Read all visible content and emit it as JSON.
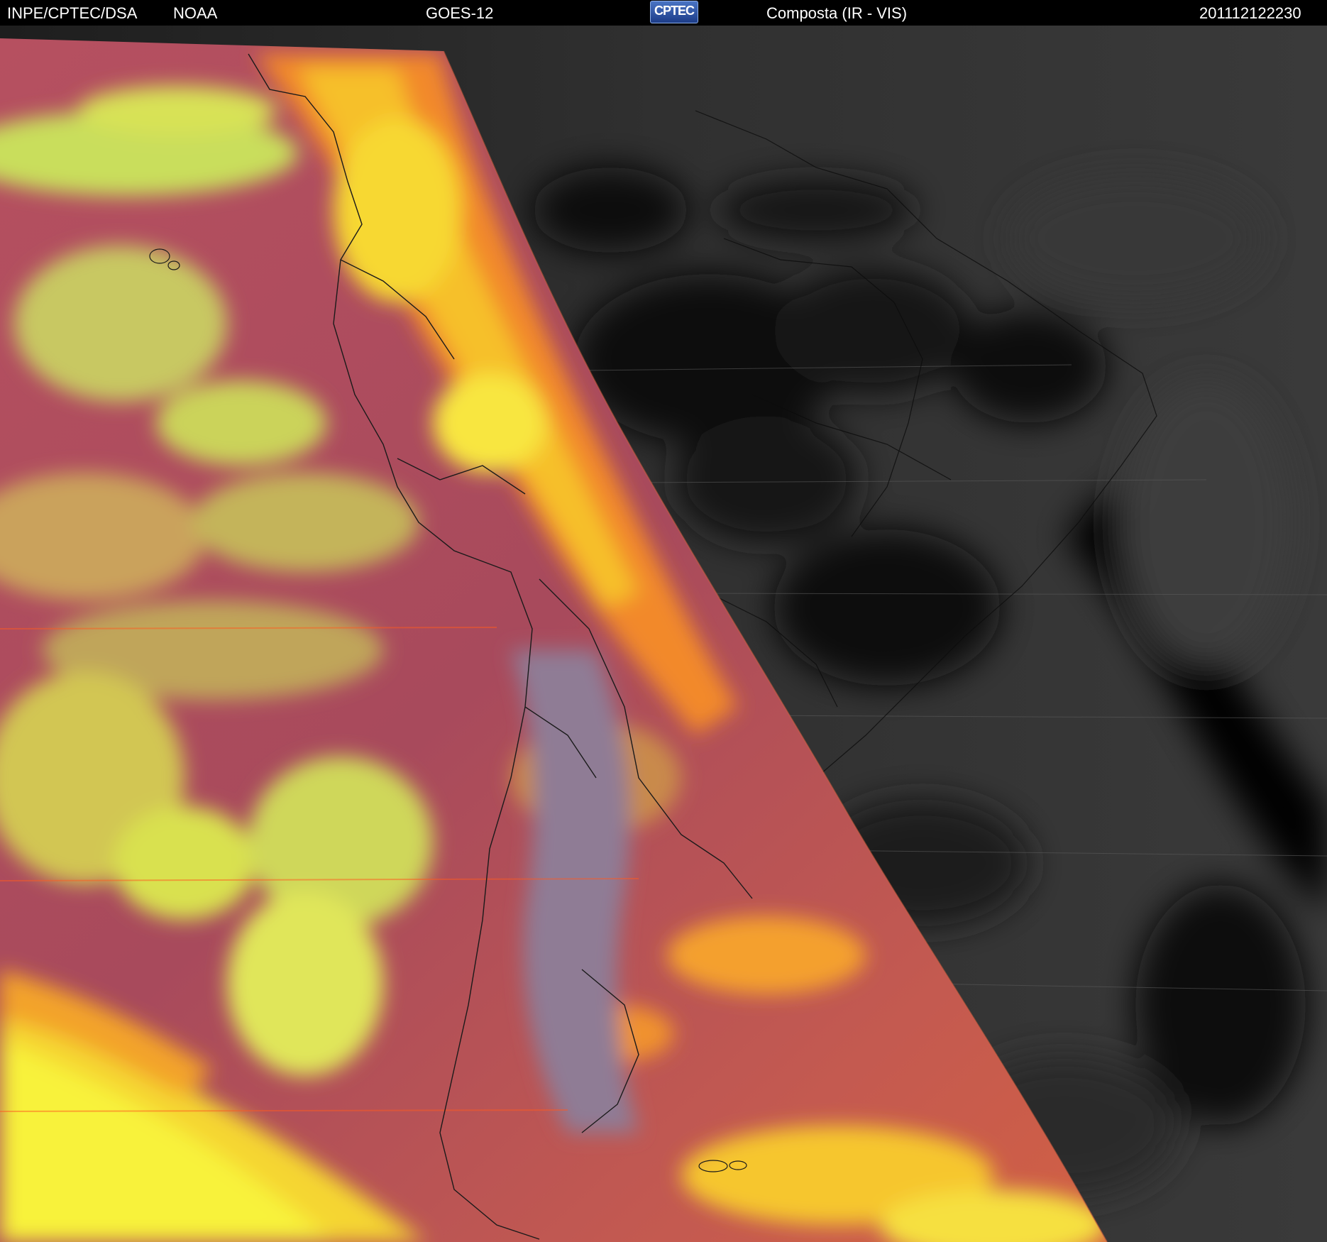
{
  "header": {
    "agency": "INPE/CPTEC/DSA",
    "provider": "NOAA",
    "satellite": "GOES-12",
    "logo_text": "CPTEC",
    "product": "Composta (IR - VIS)",
    "timestamp": "201112122230"
  },
  "image": {
    "day_side_palette": [
      "#b24a5a",
      "#d45a4a",
      "#f08a2a",
      "#f6c52a",
      "#f4f23a",
      "#c9e25a"
    ],
    "night_side_palette": [
      "#0a0a0a",
      "#2c2c2c",
      "#444444"
    ],
    "land_outline_color": "#111111"
  }
}
